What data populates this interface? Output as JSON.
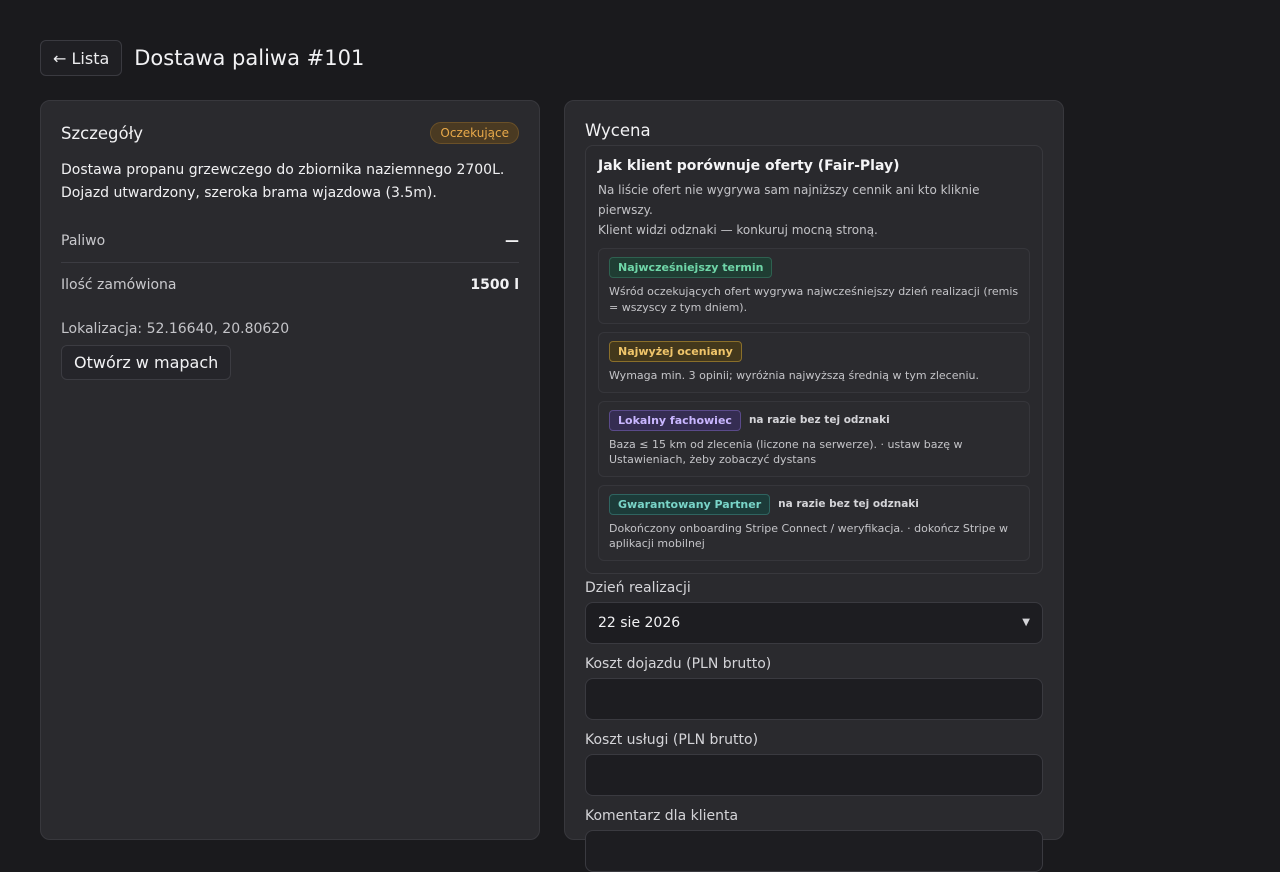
{
  "header": {
    "back_label": "← Lista",
    "title": "Dostawa paliwa #101"
  },
  "details": {
    "title": "Szczegóły",
    "status": "Oczekujące",
    "description_line1": "Dostawa propanu grzewczego do zbiornika naziemnego 2700L.",
    "description_line2": "Dojazd utwardzony, szeroka brama wjazdowa (3.5m).",
    "rows": [
      {
        "label": "Paliwo",
        "value": "—"
      },
      {
        "label": "Ilość zamówiona",
        "value": "1500 l"
      }
    ],
    "location": "Lokalizacja: 52.16640, 20.80620",
    "maps_button": "Otwórz w mapach"
  },
  "quote": {
    "title": "Wycena",
    "info": {
      "title": "Jak klient porównuje oferty (Fair-Play)",
      "text_line1": "Na liście ofert nie wygrywa sam najniższy cennik ani kto kliknie pierwszy.",
      "text_line2": "Klient widzi odznaki — konkuruj mocną stroną.",
      "badges": [
        {
          "label": "Najwcześniejszy termin",
          "status": "",
          "desc": "Wśród oczekujących ofert wygrywa najwcześniejszy dzień realizacji (remis = wszyscy z tym dniem).",
          "color": "#6fd6a8"
        },
        {
          "label": "Najwyżej oceniany",
          "status": "",
          "desc": "Wymaga min. 3 opinii; wyróżnia najwyższą średnią w tym zleceniu.",
          "color": "#f0c56a"
        },
        {
          "label": "Lokalny fachowiec",
          "status": "na razie bez tej odznaki",
          "desc": "Baza ≤ 15 km od zlecenia (liczone na serwerze). · ustaw bazę w Ustawieniach, żeby zobaczyć dystans",
          "color": "#c9b6ff"
        },
        {
          "label": "Gwarantowany Partner",
          "status": "na razie bez tej odznaki",
          "desc": "Dokończony onboarding Stripe Connect / weryfikacja. · dokończ Stripe w aplikacji mobilnej",
          "color": "#79d4c8"
        }
      ]
    },
    "date_label": "Dzień realizacji",
    "date_value": "22 sie 2026",
    "travel_label": "Koszt dojazdu (PLN brutto)",
    "travel_value": "",
    "service_label": "Koszt usługi (PLN brutto)",
    "service_value": "",
    "comment_label": "Komentarz dla klienta"
  },
  "icons": {
    "caret": "chevron-down-icon"
  }
}
